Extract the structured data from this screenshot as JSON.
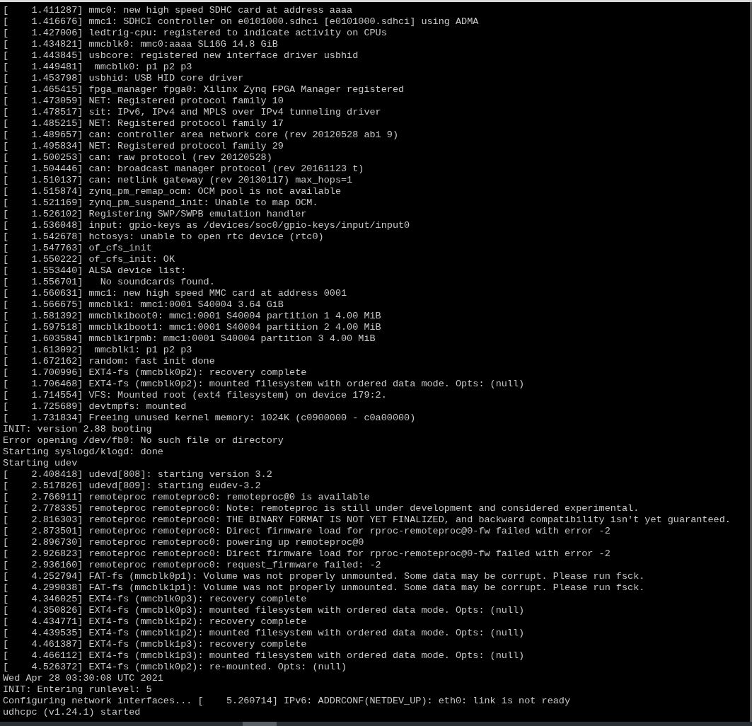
{
  "terminal": {
    "lines": [
      "[    1.411287] mmc0: new high speed SDHC card at address aaaa",
      "[    1.416676] mmc1: SDHCI controller on e0101000.sdhci [e0101000.sdhci] using ADMA",
      "[    1.427006] ledtrig-cpu: registered to indicate activity on CPUs",
      "[    1.434821] mmcblk0: mmc0:aaaa SL16G 14.8 GiB",
      "[    1.443845] usbcore: registered new interface driver usbhid",
      "[    1.449481]  mmcblk0: p1 p2 p3",
      "[    1.453798] usbhid: USB HID core driver",
      "[    1.465415] fpga_manager fpga0: Xilinx Zynq FPGA Manager registered",
      "[    1.473059] NET: Registered protocol family 10",
      "[    1.478517] sit: IPv6, IPv4 and MPLS over IPv4 tunneling driver",
      "[    1.485215] NET: Registered protocol family 17",
      "[    1.489657] can: controller area network core (rev 20120528 abi 9)",
      "[    1.495834] NET: Registered protocol family 29",
      "[    1.500253] can: raw protocol (rev 20120528)",
      "[    1.504446] can: broadcast manager protocol (rev 20161123 t)",
      "[    1.510137] can: netlink gateway (rev 20130117) max_hops=1",
      "[    1.515874] zynq_pm_remap_ocm: OCM pool is not available",
      "[    1.521169] zynq_pm_suspend_init: Unable to map OCM.",
      "[    1.526102] Registering SWP/SWPB emulation handler",
      "[    1.536048] input: gpio-keys as /devices/soc0/gpio-keys/input/input0",
      "[    1.542678] hctosys: unable to open rtc device (rtc0)",
      "[    1.547763] of_cfs_init",
      "[    1.550222] of_cfs_init: OK",
      "[    1.553440] ALSA device list:",
      "[    1.556701]   No soundcards found.",
      "[    1.560631] mmc1: new high speed MMC card at address 0001",
      "[    1.566675] mmcblk1: mmc1:0001 S40004 3.64 GiB",
      "[    1.581392] mmcblk1boot0: mmc1:0001 S40004 partition 1 4.00 MiB",
      "[    1.597518] mmcblk1boot1: mmc1:0001 S40004 partition 2 4.00 MiB",
      "[    1.603584] mmcblk1rpmb: mmc1:0001 S40004 partition 3 4.00 MiB",
      "[    1.613092]  mmcblk1: p1 p2 p3",
      "[    1.672162] random: fast init done",
      "[    1.700996] EXT4-fs (mmcblk0p2): recovery complete",
      "[    1.706468] EXT4-fs (mmcblk0p2): mounted filesystem with ordered data mode. Opts: (null)",
      "[    1.714554] VFS: Mounted root (ext4 filesystem) on device 179:2.",
      "[    1.725689] devtmpfs: mounted",
      "[    1.731834] Freeing unused kernel memory: 1024K (c0900000 - c0a00000)",
      "INIT: version 2.88 booting",
      "Error opening /dev/fb0: No such file or directory",
      "Starting syslogd/klogd: done",
      "Starting udev",
      "[    2.408418] udevd[808]: starting version 3.2",
      "[    2.517826] udevd[809]: starting eudev-3.2",
      "[    2.766911] remoteproc remoteproc0: remoteproc@0 is available",
      "[    2.778335] remoteproc remoteproc0: Note: remoteproc is still under development and considered experimental.",
      "[    2.816303] remoteproc remoteproc0: THE BINARY FORMAT IS NOT YET FINALIZED, and backward compatibility isn't yet guaranteed.",
      "[    2.873501] remoteproc remoteproc0: Direct firmware load for rproc-remoteproc@0-fw failed with error -2",
      "[    2.896730] remoteproc remoteproc0: powering up remoteproc@0",
      "[    2.926823] remoteproc remoteproc0: Direct firmware load for rproc-remoteproc@0-fw failed with error -2",
      "[    2.936160] remoteproc remoteproc0: request_firmware failed: -2",
      "[    4.252794] FAT-fs (mmcblk0p1): Volume was not properly unmounted. Some data may be corrupt. Please run fsck.",
      "[    4.299038] FAT-fs (mmcblk1p1): Volume was not properly unmounted. Some data may be corrupt. Please run fsck.",
      "[    4.346025] EXT4-fs (mmcblk0p3): recovery complete",
      "[    4.350826] EXT4-fs (mmcblk0p3): mounted filesystem with ordered data mode. Opts: (null)",
      "[    4.434771] EXT4-fs (mmcblk1p2): recovery complete",
      "[    4.439535] EXT4-fs (mmcblk1p2): mounted filesystem with ordered data mode. Opts: (null)",
      "[    4.461387] EXT4-fs (mmcblk1p3): recovery complete",
      "[    4.466112] EXT4-fs (mmcblk1p3): mounted filesystem with ordered data mode. Opts: (null)",
      "[    4.526372] EXT4-fs (mmcblk0p2): re-mounted. Opts: (null)",
      "Wed Apr 28 03:30:08 UTC 2021",
      "INIT: Entering runlevel: 5",
      "Configuring network interfaces... [    5.260714] IPv6: ADDRCONF(NETDEV_UP): eth0: link is not ready",
      "udhcpc (v1.24.1) started"
    ]
  }
}
